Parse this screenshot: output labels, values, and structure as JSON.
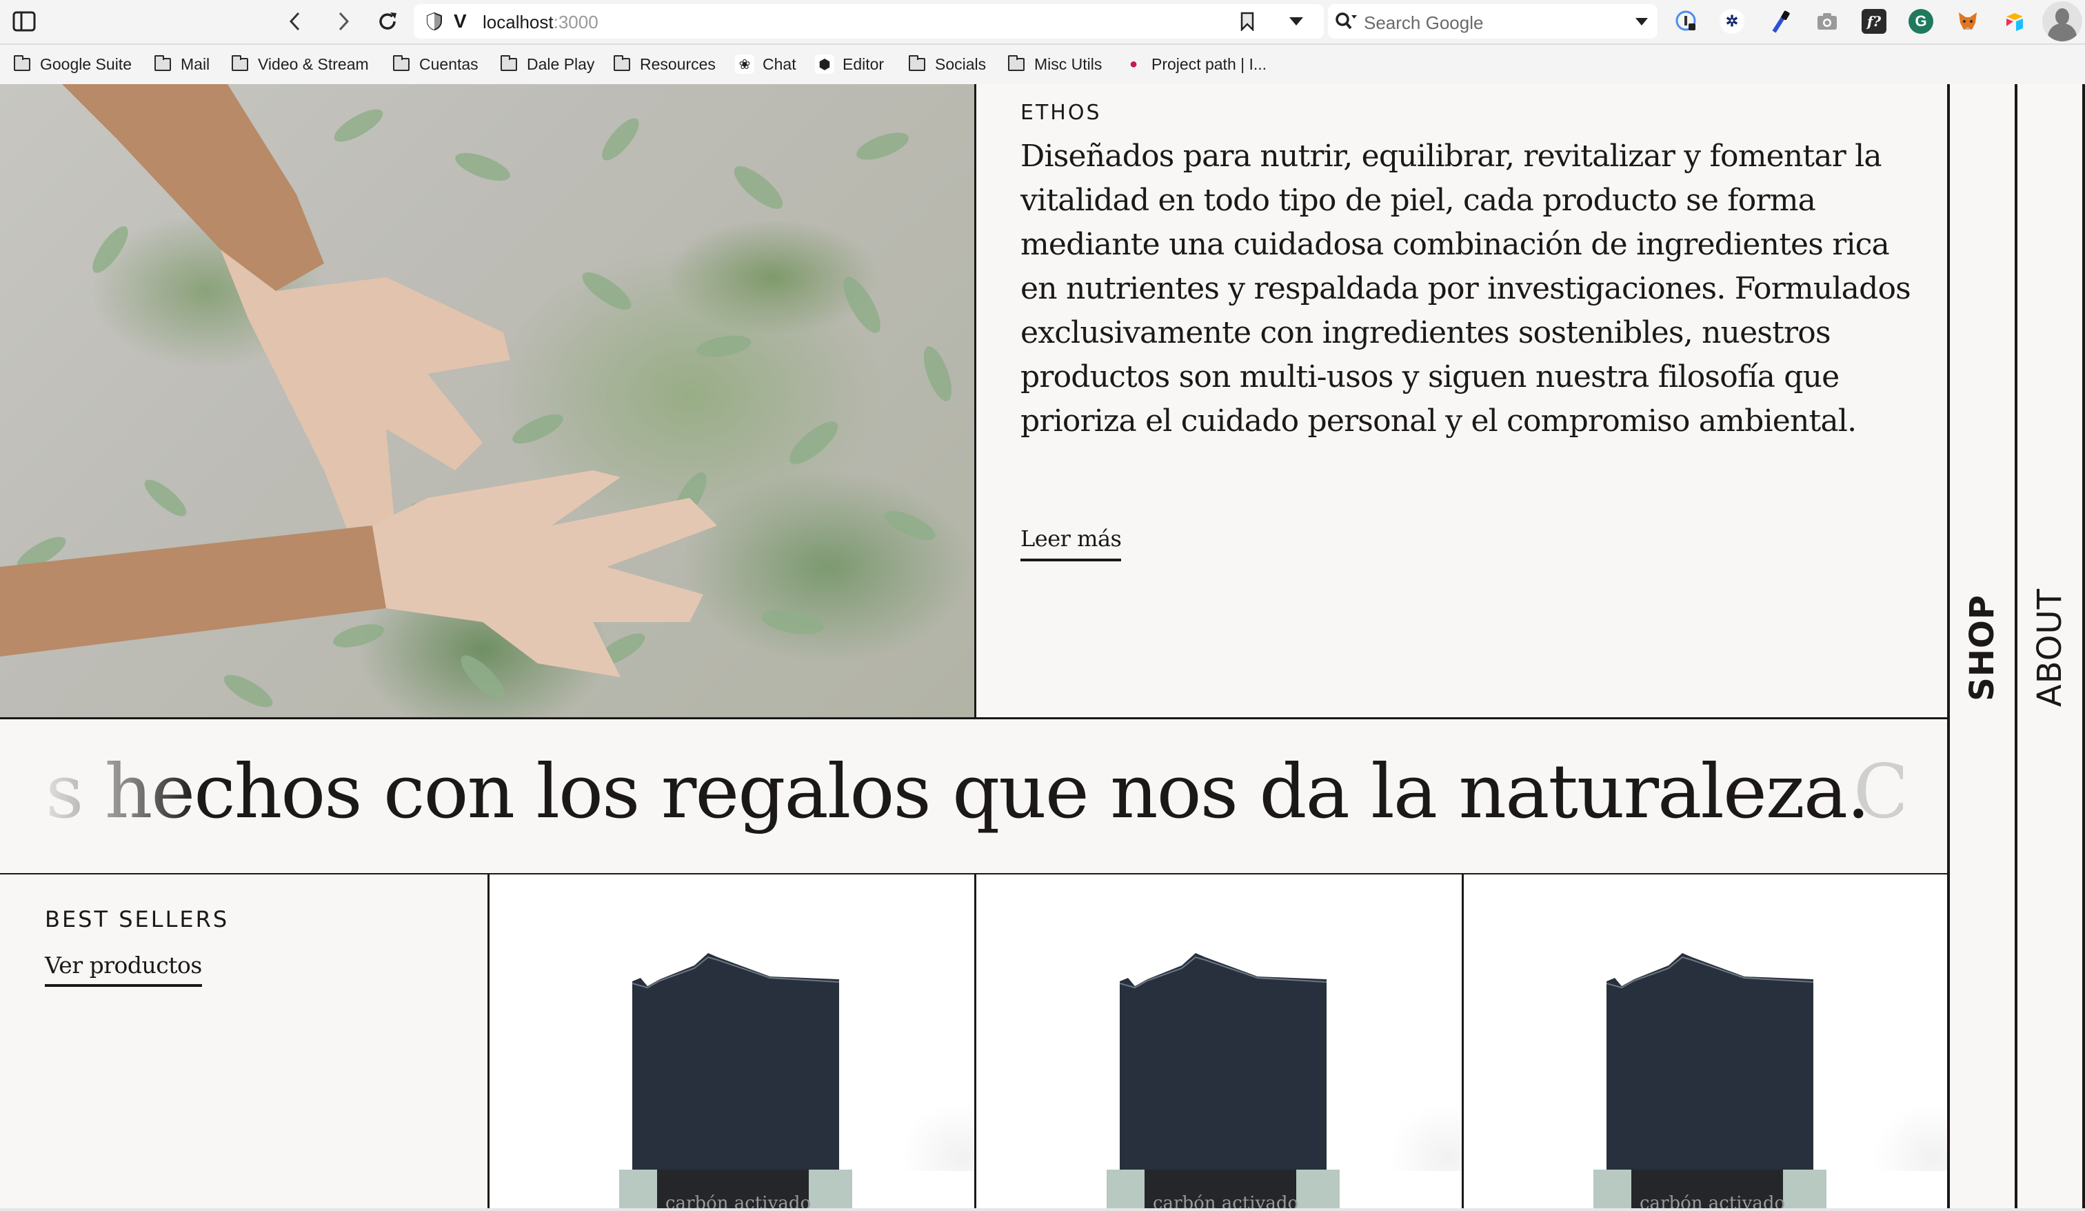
{
  "browser": {
    "url_host": "localhost",
    "url_port": ":3000",
    "search_placeholder": "Search Google",
    "extensions": [
      {
        "name": "password-manager-icon",
        "glyph": "①"
      },
      {
        "name": "stars-extension-icon",
        "glyph": "✲"
      },
      {
        "name": "color-picker-icon",
        "glyph": "✎"
      },
      {
        "name": "screenshot-icon",
        "glyph": "◉"
      },
      {
        "name": "font-identifier-icon",
        "glyph": "f?"
      },
      {
        "name": "grammarly-icon",
        "glyph": "G"
      },
      {
        "name": "metamask-icon",
        "glyph": "◆"
      },
      {
        "name": "airtable-icon",
        "glyph": "▸"
      }
    ],
    "bookmarks": [
      {
        "label": "Google Suite",
        "type": "folder"
      },
      {
        "label": "Mail",
        "type": "folder"
      },
      {
        "label": "Video & Stream",
        "type": "folder"
      },
      {
        "label": "Cuentas",
        "type": "folder"
      },
      {
        "label": "Dale Play",
        "type": "folder"
      },
      {
        "label": "Resources",
        "type": "folder"
      },
      {
        "label": "Chat",
        "type": "openai-icon"
      },
      {
        "label": "Editor",
        "type": "codepen-icon"
      },
      {
        "label": "Socials",
        "type": "folder"
      },
      {
        "label": "Misc Utils",
        "type": "folder"
      },
      {
        "label": "Project path | I...",
        "type": "raspberry-pi-icon"
      }
    ]
  },
  "ethos": {
    "label": "ETHOS",
    "body": "Diseñados para nutrir, equilibrar, revitalizar y fomentar la vitalidad en todo tipo de piel, cada producto se forma mediante una cuidadosa combinación de ingredientes rica en nutrientes y respaldada por investigaciones. Formulados exclusivamente con ingredientes sostenibles, nuestros productos son multi-usos y siguen nuestra filosofía que prioriza el cuidado personal y el compromiso ambiental.",
    "read_more": "Leer más"
  },
  "marquee": {
    "text": "s hechos con los regalos que nos da la naturaleza.",
    "next": "C"
  },
  "best_sellers": {
    "title": "BEST SELLERS",
    "link": "Ver productos",
    "products": [
      {
        "label": "carbón activado"
      },
      {
        "label": "carbón activado"
      },
      {
        "label": "carbón activado"
      }
    ]
  },
  "side_nav": {
    "shop": "SHOP",
    "about": "ABOUT"
  },
  "colors": {
    "ink": "#1c1817",
    "page_bg": "#f8f7f5",
    "soap": "#2a3441",
    "label_mint": "#b7c9c1"
  }
}
